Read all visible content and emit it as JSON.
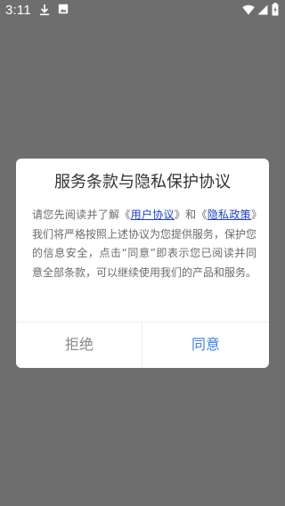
{
  "status_bar": {
    "time": "3:11",
    "icons": [
      "download-icon",
      "image-icon",
      "wifi-icon",
      "signal-icon",
      "battery-icon"
    ]
  },
  "dialog": {
    "title": "服务条款与隐私保护协议",
    "body": {
      "prefix": "请您先阅读并了解《",
      "link1": "用户协议",
      "middle": "》和《",
      "link2": "隐私政策",
      "suffix": "》我们将严格按照上述协议为您提供服务，保护您的信息安全，点击“同意”即表示您已阅读并同意全部条款，可以继续使用我们的产品和服务。"
    },
    "reject_label": "拒绝",
    "agree_label": "同意"
  },
  "colors": {
    "scrim": "#6e6e6e",
    "link": "#1a3fd1",
    "agree": "#3f80e8",
    "reject": "#888888"
  }
}
